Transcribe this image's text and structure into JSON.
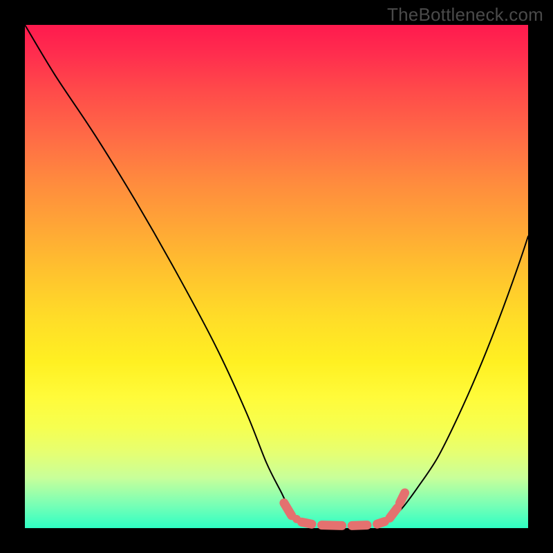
{
  "watermark": "TheBottleneck.com",
  "chart_data": {
    "type": "line",
    "title": "",
    "xlabel": "",
    "ylabel": "",
    "xlim": [
      0,
      100
    ],
    "ylim": [
      0,
      100
    ],
    "description": "V-shaped bottleneck curve on red-to-green gradient; curve descends steeply from top-left, reaches a flat minimum near x≈56-72 at y≈0-2, then rises to the right edge. A salmon dashed/dotted highlight overlays the curve near the minimum.",
    "series": [
      {
        "name": "left-branch",
        "x": [
          0,
          6,
          14,
          22,
          30,
          38,
          44,
          48,
          51,
          53,
          55
        ],
        "y": [
          100,
          90,
          78,
          65,
          51,
          36,
          23,
          13,
          7,
          3,
          1
        ]
      },
      {
        "name": "right-branch",
        "x": [
          72,
          75,
          78,
          82,
          86,
          90,
          94,
          98,
          100
        ],
        "y": [
          1,
          4,
          8,
          14,
          22,
          31,
          41,
          52,
          58
        ]
      }
    ],
    "highlight_segments": [
      {
        "x0": 51.5,
        "y0": 5.0,
        "x1": 53.0,
        "y1": 2.5
      },
      {
        "x0": 55.0,
        "y0": 1.2,
        "x1": 57.0,
        "y1": 0.8
      },
      {
        "x0": 59.0,
        "y0": 0.6,
        "x1": 63.0,
        "y1": 0.5
      },
      {
        "x0": 65.0,
        "y0": 0.5,
        "x1": 68.0,
        "y1": 0.6
      },
      {
        "x0": 70.0,
        "y0": 0.8,
        "x1": 71.5,
        "y1": 1.3
      },
      {
        "x0": 72.5,
        "y0": 2.0,
        "x1": 74.0,
        "y1": 4.0
      },
      {
        "x0": 74.5,
        "y0": 5.0,
        "x1": 75.5,
        "y1": 7.0
      }
    ],
    "highlight_dots": [
      {
        "x": 54.0,
        "y": 1.8
      }
    ]
  }
}
